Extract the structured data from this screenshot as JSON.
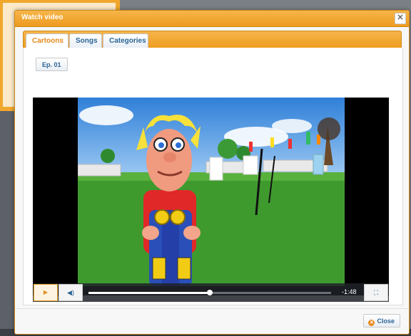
{
  "dialog": {
    "title": "Watch video",
    "close_icon": "close-x-icon",
    "tabs": [
      {
        "label": "Cartoons",
        "active": true
      },
      {
        "label": "Songs",
        "active": false
      },
      {
        "label": "Categories",
        "active": false
      }
    ],
    "episode_button": "Ep. 01",
    "close_button": "Close"
  },
  "player": {
    "time_remaining": "-1:48",
    "progress": 0.5,
    "icons": {
      "play": "play-icon",
      "volume": "volume-icon",
      "fullscreen": "fullscreen-icon"
    }
  },
  "colors": {
    "accent_orange": "#ee9b1f",
    "link_blue": "#2a6496",
    "sky": "#4f9be6",
    "grass": "#3f9a2e"
  }
}
